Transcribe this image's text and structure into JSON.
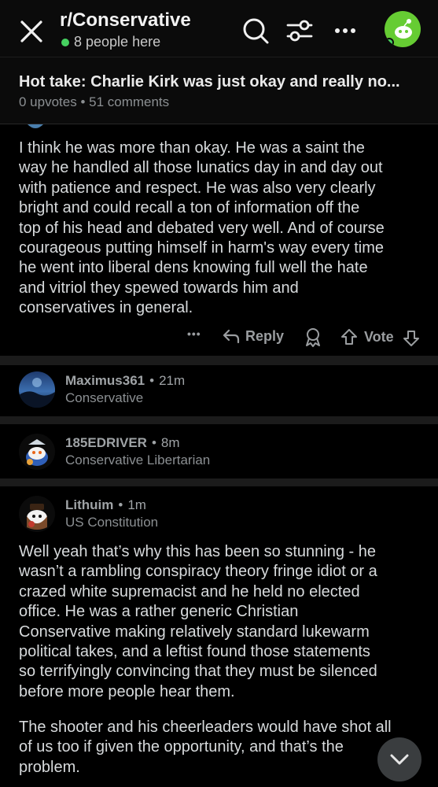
{
  "header": {
    "subreddit": "r/Conservative",
    "online_count": "8 people here",
    "icons": [
      "close-icon",
      "search-icon",
      "filter-icon",
      "more-icon",
      "user-avatar"
    ]
  },
  "post": {
    "title": "Hot take: Charlie Kirk was just okay and really no...",
    "meta": "0 upvotes • 51 comments"
  },
  "comment1": {
    "lines": [
      "I think he was more than okay. He was a saint the",
      "way he handled all those lunatics day in and day out",
      "with patience and respect. He was also very clearly",
      "bright and could recall a ton of information off the",
      "top of his head and debated very well. And of course",
      "courageous putting himself in harm's way every time",
      "he went into liberal dens knowing full well the hate",
      "and vitriol they spewed towards him and",
      "conservatives in general."
    ],
    "actions": {
      "more": "•••",
      "reply": "Reply",
      "vote": "Vote"
    }
  },
  "collapsed": [
    {
      "user": "Maximus361",
      "age": "21m",
      "flair": "Conservative"
    },
    {
      "user": "185EDRIVER",
      "age": "8m",
      "flair": "Conservative Libertarian"
    }
  ],
  "comment2": {
    "user": "Lithuim",
    "age": "1m",
    "flair": "US Constitution",
    "para1": [
      "Well yeah that’s why this has been so stunning - he",
      "wasn’t a rambling conspiracy theory fringe idiot or a",
      "crazed white supremacist and he held no elected",
      "office.  He was a rather generic Christian",
      "Conservative making relatively standard lukewarm",
      "political takes, and a leftist found those statements",
      "so terrifyingly convincing that they must be silenced",
      "before more people hear them."
    ],
    "para2": [
      "The shooter and his cheerleaders would have shot all",
      "of us too if given the opportunity, and that’s the",
      "problem."
    ]
  },
  "colors": {
    "background": "#000000",
    "online_green": "#46d160",
    "avatar_green": "#66cc33",
    "separator": "#1b1b1b"
  }
}
